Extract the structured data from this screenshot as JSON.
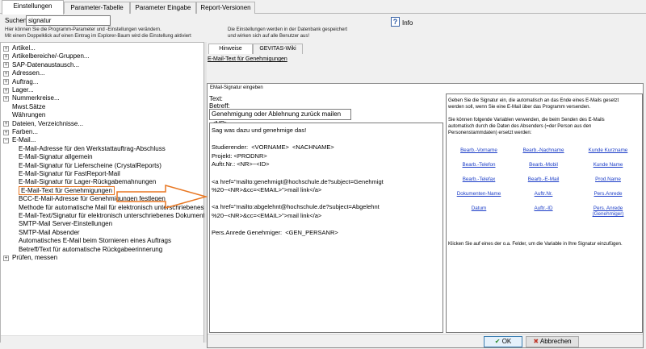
{
  "tabs": [
    "Einstellungen",
    "Parameter-Tabelle",
    "Parameter Eingabe",
    "Report-Versionen"
  ],
  "search": {
    "label": "Suchen:",
    "value": "signatur"
  },
  "hints": [
    "Hier können Sie die Programm-Parameter und -Einstellungen verändern.",
    "Mit einem Doppelklick auf einen Eintrag im Explorer-Baum wird die Einstellung  aktiviert"
  ],
  "db_hints": [
    "Die Einstellungen werden in der Datenbank gespeichert",
    "und wirken sich auf alle Benutzer aus!"
  ],
  "info": {
    "icon": "question-help-icon",
    "label": "Info"
  },
  "tree": {
    "items": [
      {
        "label": "Artikel...",
        "expander": "+"
      },
      {
        "label": "Artikelbereiche/-Gruppen...",
        "expander": "+"
      },
      {
        "label": "SAP-Datenaustausch...",
        "expander": "+"
      },
      {
        "label": "Adressen...",
        "expander": "+"
      },
      {
        "label": "Auftrag...",
        "expander": "+"
      },
      {
        "label": "Lager...",
        "expander": "+"
      },
      {
        "label": "Nummerkreise...",
        "expander": "+"
      },
      {
        "label": "Mwst.Sätze",
        "expander": ""
      },
      {
        "label": "Währungen",
        "expander": ""
      },
      {
        "label": "Dateien, Verzeichnisse...",
        "expander": "+"
      },
      {
        "label": "Farben...",
        "expander": "+"
      },
      {
        "label": "E-Mail...",
        "expander": "-"
      }
    ],
    "email_children": [
      "E-Mail-Adresse für den Werkstattauftrag-Abschluss",
      "E-Mail-Signatur allgemein",
      "E-Mail-Signatur für Lieferscheine (CrystalReports)",
      "E-Mail-Signatur für FastReport-Mail",
      "E-Mail-Signatur für Lager-Rückgabemahnungen",
      "E-Mail-Text für Genehmigungen",
      "BCC-E-Mail-Adresse für Genehmigungen festlegen",
      "Methode für automatische Mail für elektronisch unterschriebenes Dok",
      "E-Mail-Text/Signatur für elektronisch unterschriebenes Dokument",
      "SMTP-Mail Server-Einstellungen",
      "SMTP-Mail Absender",
      "Automatisches E-Mail beim Stornieren eines Auftrags",
      "Betreff/Text für automatische Rückgabeerinnerung"
    ],
    "after": [
      {
        "label": "Prüfen, messen",
        "expander": "+"
      }
    ]
  },
  "right": {
    "tabs": [
      "Hinweise",
      "GEVITAS-Wiki"
    ],
    "title": "E-Mail-Text für Genehmigungen"
  },
  "dialog": {
    "title": "EMail-Signatur eingeben",
    "text_label": "Text:",
    "subject_label": "Betreff:",
    "subject_value": "Genehmigung oder Ablehnung zurück mailen  <NR>",
    "body_lines": [
      "Sag was dazu und genehmige das!",
      "",
      "Studierender:  <VORNAME>  <NACHNAME>",
      "Projekt: <PRODNR>",
      "Auftr.Nr.: <NR>~<ID>",
      "",
      "<a href=\"mailto:genehmigt@hochschule.de?subject=Genehmigt",
      "%20~<NR>&cc=<EMAIL>\">mail link</a>",
      "",
      "<a href=\"mailto:abgelehnt@hochschule.de?subject=Abgelehnt",
      "%20~<NR>&cc=<EMAIL>\">mail link</a>",
      "",
      "Pers.Anrede Genehmiger:  <GEN_PERSANR>"
    ],
    "help_lines_1": [
      "Geben Sie die Signatur ein, die automatisch an das Ende eines E-Mails gesetzt",
      "werden soll, wenn Sie eine E-Mail über das Programm versenden."
    ],
    "help_lines_2": [
      "Sie können folgende Variablen verwenden, die beim Senden des E-Mails",
      "automatisch durch die Daten des Absenders (=der Person aus den",
      "Personenstammdaten) ersetzt werden:"
    ],
    "variables": [
      [
        "Bearb.-Vorname",
        "Bearb.-Nachname",
        "Kunde Kurzname"
      ],
      [
        "Bearb.-Telefon",
        "Bearb.-Mobil",
        "Kunde Name"
      ],
      [
        "Bearb.-Telefax",
        "Bearb.-E-Mail",
        "Prod.Name"
      ],
      [
        "Dokumenten-Name",
        "Auftr.Nr.",
        "Pers.Anrede"
      ],
      [
        "Datum",
        "Auftr.-ID",
        "Pers. Anrede (Genehmiger)"
      ]
    ],
    "help_footer": "Klicken Sie auf eines der o.a. Felder, um die Variable in Ihre Signatur einzufügen.",
    "ok_label": "OK",
    "cancel_label": "Abbrechen"
  },
  "colors": {
    "highlight": "#e87722",
    "link": "#1a3cc7"
  }
}
